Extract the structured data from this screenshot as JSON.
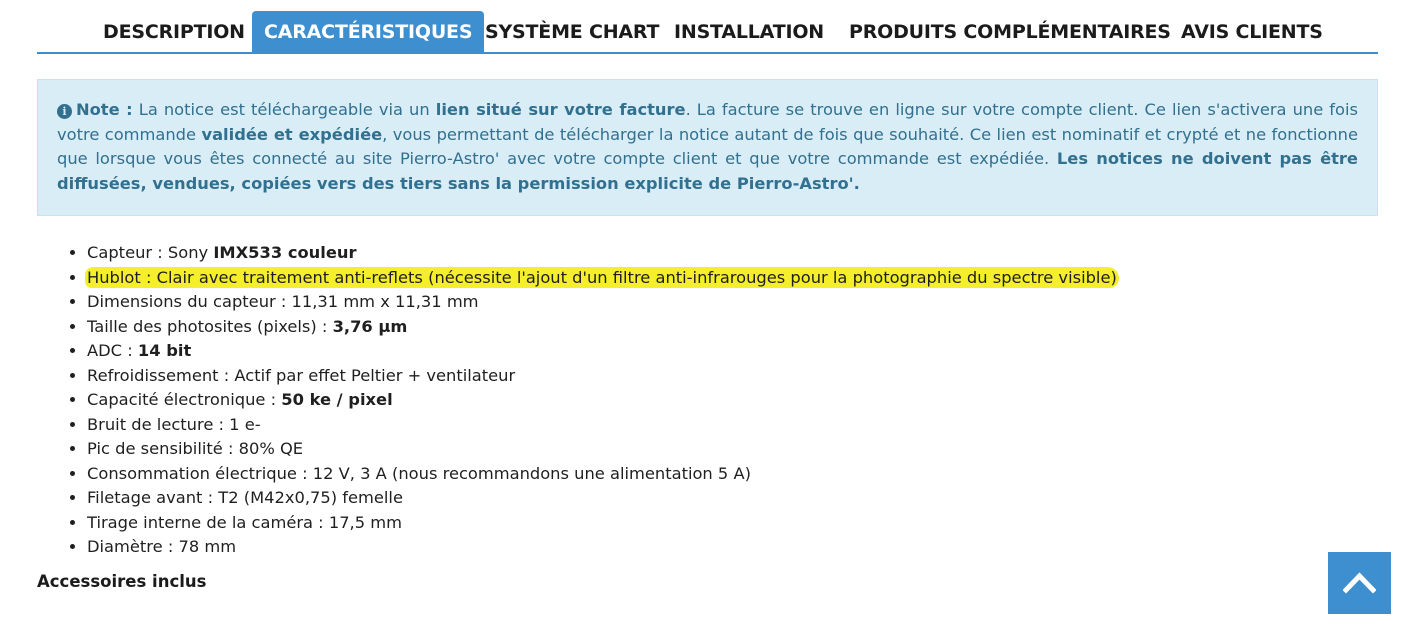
{
  "tabs": [
    {
      "label": "DESCRIPTION",
      "active": false
    },
    {
      "label": "CARACTÉRISTIQUES",
      "active": true
    },
    {
      "label": "SYSTÈME CHART",
      "active": false
    },
    {
      "label": "INSTALLATION",
      "active": false
    },
    {
      "label": "PRODUITS COMPLÉMENTAIRES",
      "active": false
    },
    {
      "label": "AVIS CLIENTS",
      "active": false
    }
  ],
  "note": {
    "icon": "info-circle-icon",
    "label": "Note :",
    "t1": " La notice est téléchargeable via un ",
    "b1": "lien situé sur votre facture",
    "t2": ". La facture se trouve en ligne sur votre compte client. Ce lien s'activera une fois votre commande ",
    "b2": "validée et expédiée",
    "t3": ", vous permettant de télécharger la notice autant de fois que souhaité. Ce lien est nominatif et crypté et ne fonctionne que lorsque vous êtes connecté au site Pierro-Astro' avec votre compte client et que votre commande est expédiée. ",
    "b3": "Les notices ne doivent pas être diffusées, vendues, copiées vers des tiers sans la permission explicite de Pierro-Astro'."
  },
  "specs": [
    {
      "text": "Capteur : Sony ",
      "bold": "IMX533 couleur"
    },
    {
      "text": "Hublot : Clair avec traitement anti-reflets (nécessite l'ajout d'un filtre anti-infrarouges pour la photographie du spectre visible)",
      "highlight": true
    },
    {
      "text": "Dimensions du capteur : 11,31 mm x 11,31 mm"
    },
    {
      "text": "Taille des photosites (pixels) : ",
      "bold": "3,76 µm"
    },
    {
      "text": "ADC : ",
      "bold": "14 bit"
    },
    {
      "text": "Refroidissement : Actif par effet Peltier + ventilateur"
    },
    {
      "text": "Capacité électronique : ",
      "bold": "50 ke / pixel"
    },
    {
      "text": "Bruit de lecture : 1 e-"
    },
    {
      "text": "Pic de sensibilité : 80% QE"
    },
    {
      "text": "Consommation électrique : 12 V, 3 A (nous recommandons une alimentation 5 A)"
    },
    {
      "text": "Filetage avant : T2 (M42x0,75) femelle"
    },
    {
      "text": "Tirage interne de la caméra : 17,5 mm"
    },
    {
      "text": "Diamètre : 78 mm"
    }
  ],
  "accessories_heading": "Accessoires inclus",
  "back_to_top_icon": "chevron-up-icon",
  "colors": {
    "accent": "#3d8fcf",
    "alert_bg": "#d9edf7",
    "alert_text": "#31708f",
    "highlight": "#f4ef2a"
  }
}
